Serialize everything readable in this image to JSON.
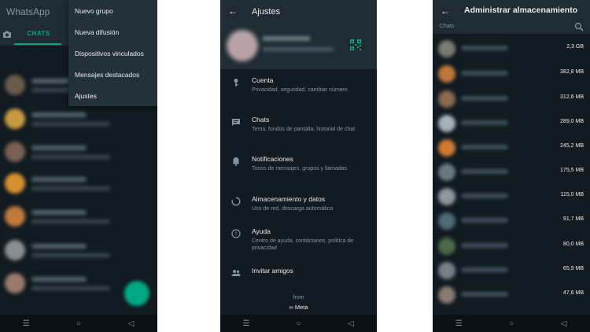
{
  "screen1": {
    "app_title": "WhatsApp",
    "tab_chats": "CHATS",
    "menu_items": [
      "Nuevo grupo",
      "Nueva difusión",
      "Dispositivos vinculados",
      "Mensajes destacados",
      "Ajustes"
    ]
  },
  "screen2": {
    "title": "Ajustes",
    "settings": [
      {
        "title": "Cuenta",
        "subtitle": "Privacidad, seguridad, cambiar número",
        "icon": "key-icon"
      },
      {
        "title": "Chats",
        "subtitle": "Tema, fondos de pantalla, historial de chat",
        "icon": "chat-icon"
      },
      {
        "title": "Notificaciones",
        "subtitle": "Tonos de mensajes, grupos y llamadas",
        "icon": "bell-icon"
      },
      {
        "title": "Almacenamiento y datos",
        "subtitle": "Uso de red, descarga automática",
        "icon": "storage-circle-icon"
      },
      {
        "title": "Ayuda",
        "subtitle": "Centro de ayuda, contáctanos, política de privacidad",
        "icon": "help-icon"
      },
      {
        "title": "Invitar amigos",
        "subtitle": "",
        "icon": "people-icon"
      }
    ],
    "from_label": "from",
    "meta_label": "∞ Meta"
  },
  "screen3": {
    "title": "Administrar almacenamiento",
    "chats_label": "Chats",
    "sizes": [
      "2,3 GB",
      "382,8 MB",
      "312,6 MB",
      "289,0 MB",
      "245,2 MB",
      "175,5 MB",
      "115,0 MB",
      "91,7 MB",
      "80,0 MB",
      "65,9 MB",
      "47,6 MB"
    ]
  },
  "navbar": {
    "recent": "☰",
    "home": "○",
    "back": "◁"
  },
  "colors": {
    "background": "#111b21",
    "header": "#1f2c34",
    "accent": "#00a884",
    "text": "#e9edef",
    "secondary": "#8696a0"
  }
}
